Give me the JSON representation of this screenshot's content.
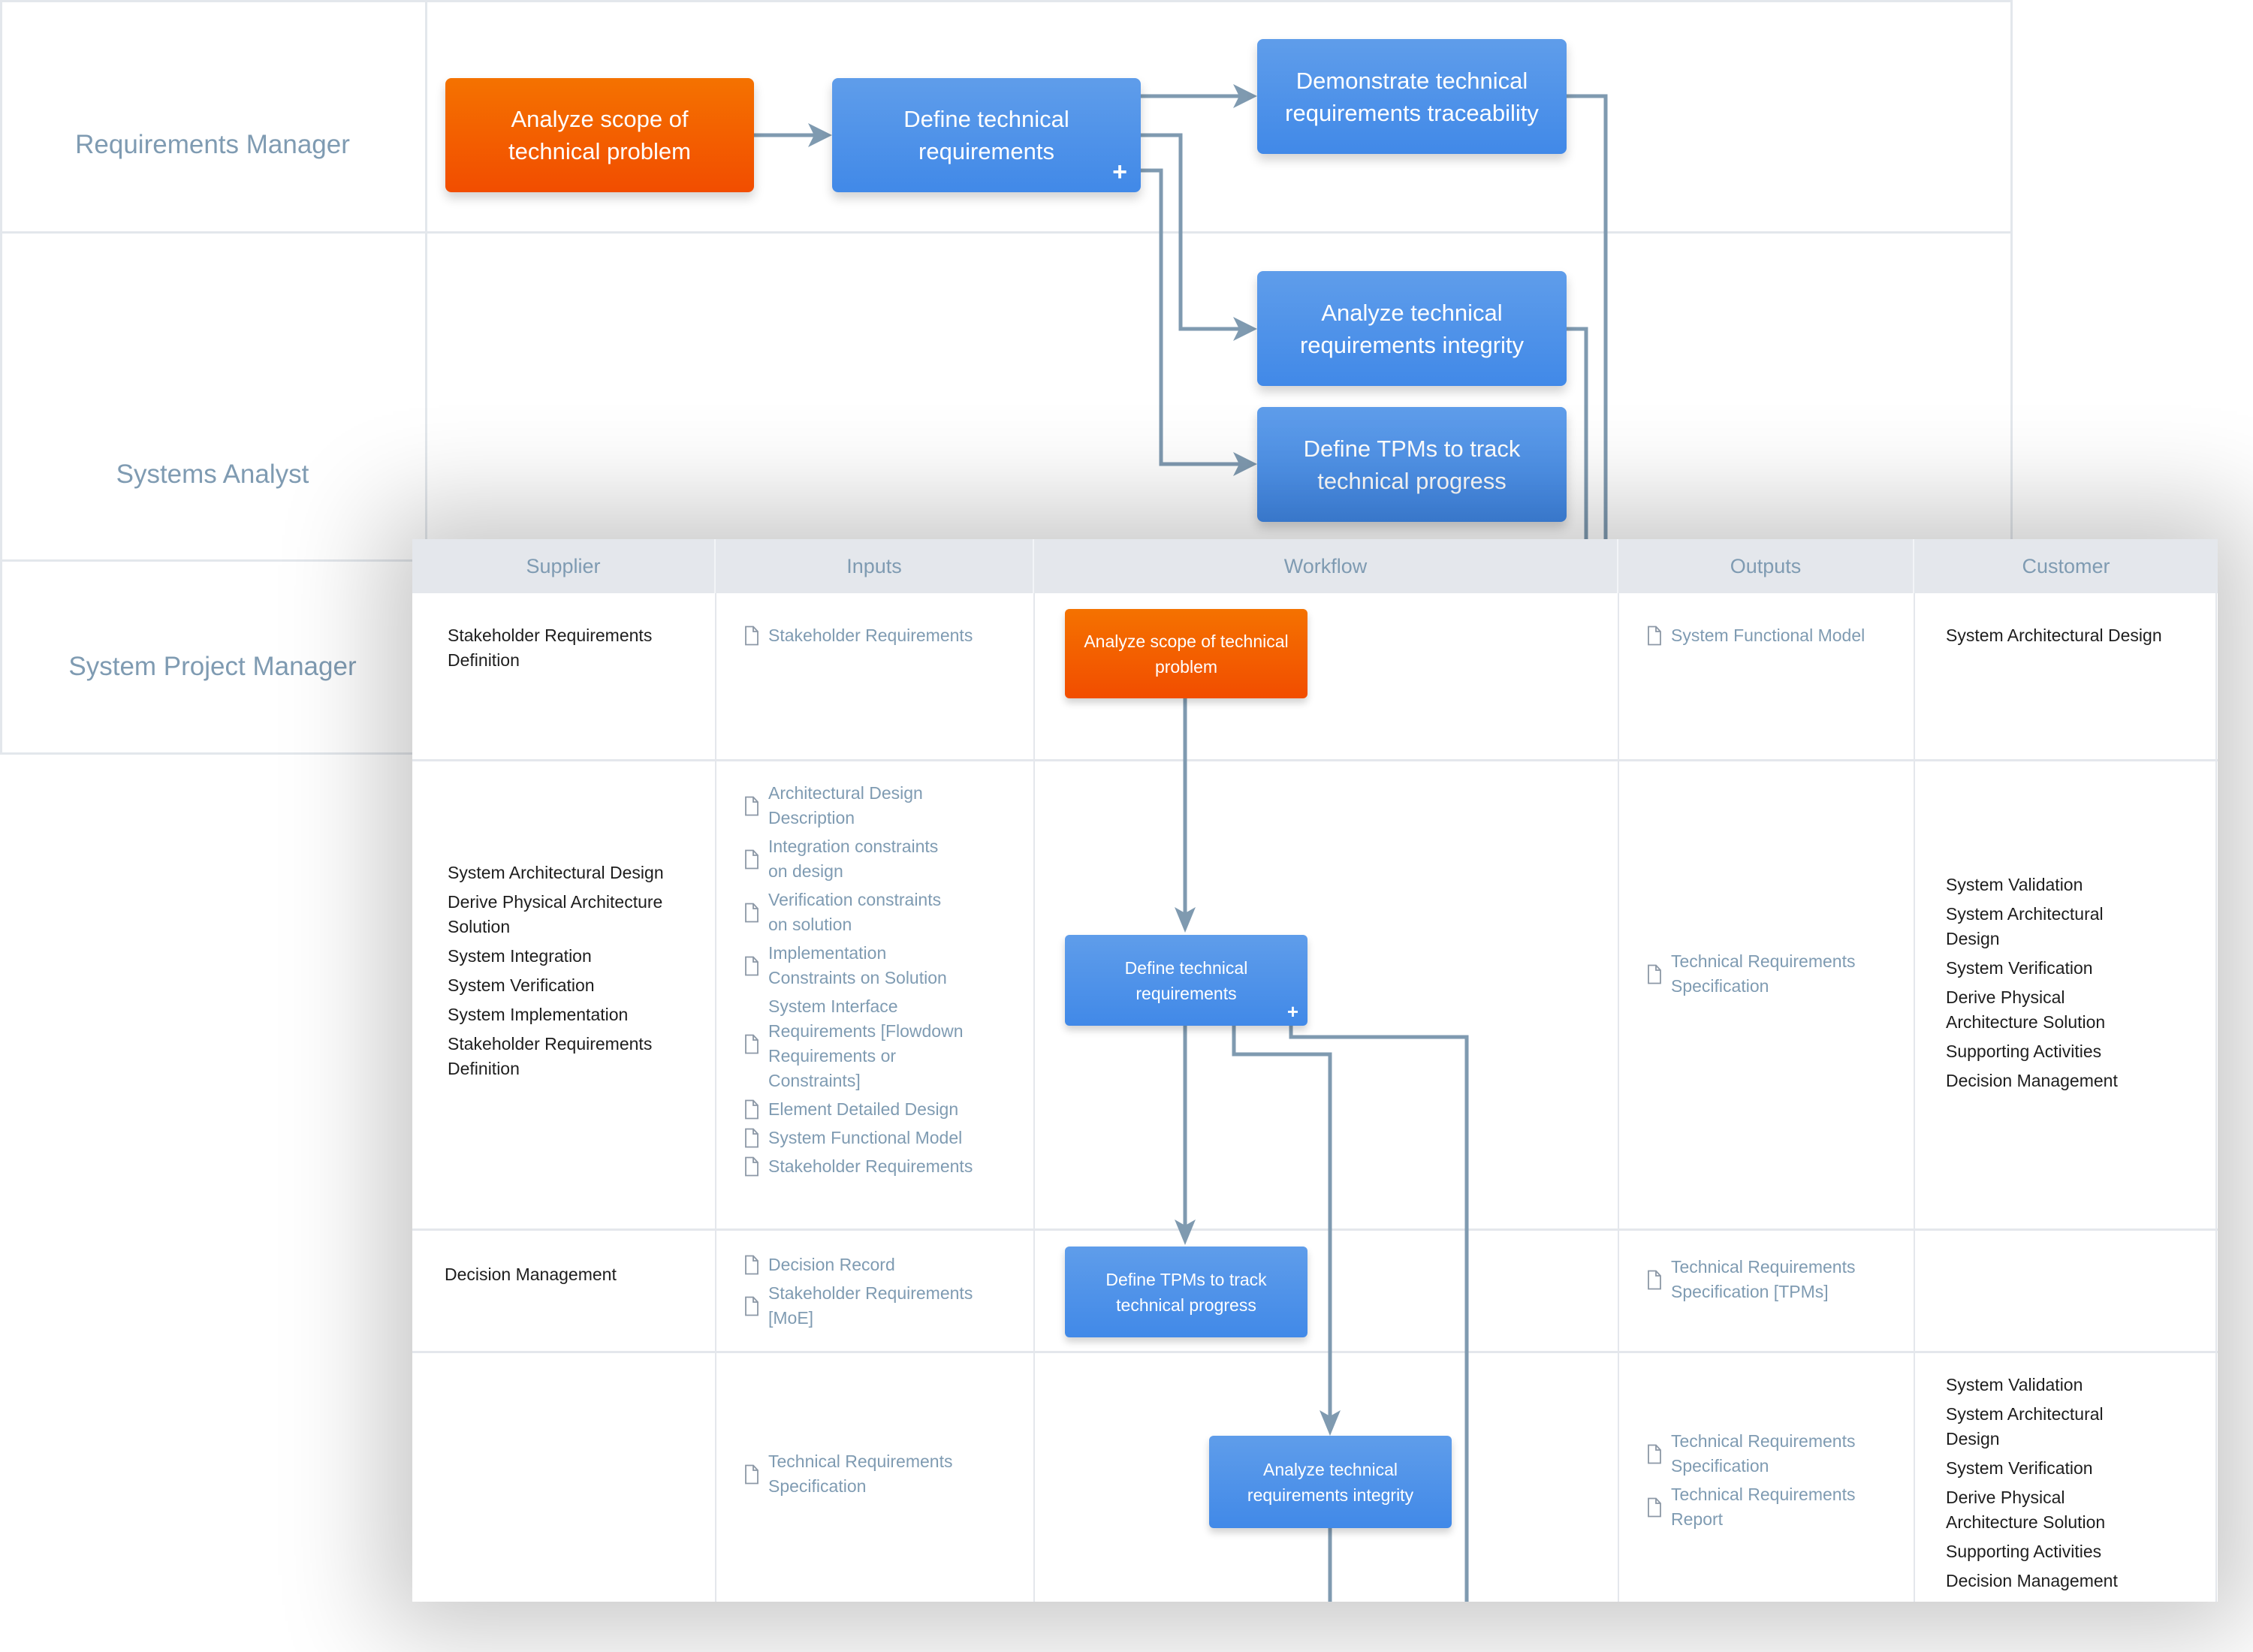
{
  "swimlane": {
    "lanes": [
      {
        "label": "Requirements Manager"
      },
      {
        "label": "Systems Analyst"
      },
      {
        "label": "System Project Manager"
      }
    ],
    "nodes": {
      "analyze_scope": {
        "label": "Analyze scope of technical problem",
        "color": "#f25c00"
      },
      "define_reqs": {
        "label": "Define technical requirements",
        "expandable": true,
        "expand_glyph": "+",
        "color": "#4a8fe8"
      },
      "demonstrate_trace": {
        "label": "Demonstrate technical requirements traceability",
        "color": "#4a8fe8"
      },
      "analyze_integrity": {
        "label": "Analyze technical requirements integrity",
        "color": "#4a8fe8"
      },
      "define_tpms": {
        "label": "Define TPMs to track technical progress",
        "color": "#4a8fe8"
      }
    },
    "connector_color": "#7f9ab0"
  },
  "sipoc": {
    "headers": [
      "Supplier",
      "Inputs",
      "Workflow",
      "Outputs",
      "Customer"
    ],
    "rows": [
      {
        "suppliers": [
          "Stakeholder Requirements Definition"
        ],
        "inputs": [
          "Stakeholder Requirements"
        ],
        "workflow": {
          "label": "Analyze scope of technical problem",
          "kind": "start"
        },
        "outputs": [
          "System Functional Model"
        ],
        "customers": [
          "System Architectural Design"
        ]
      },
      {
        "suppliers": [
          "System Architectural Design",
          "Derive Physical Architecture Solution",
          "System Integration",
          "System Verification",
          "System Implementation",
          "Stakeholder Requirements Definition"
        ],
        "inputs": [
          "Architectural Design Description",
          "Integration constraints on design",
          "Verification constraints on solution",
          "Implementation Constraints on Solution",
          "System Interface Requirements [Flowdown Requirements or  Constraints]",
          "Element Detailed Design",
          "System Functional Model",
          "Stakeholder Requirements"
        ],
        "workflow": {
          "label": "Define technical requirements",
          "kind": "task",
          "expandable": true,
          "expand_glyph": "+"
        },
        "outputs": [
          "Technical Requirements Specification"
        ],
        "customers": [
          "System Validation",
          "System Architectural Design",
          "System Verification",
          "Derive Physical Architecture Solution",
          "Supporting Activities",
          "Decision Management"
        ]
      },
      {
        "suppliers": [
          "Decision Management"
        ],
        "inputs": [
          "Decision Record",
          "Stakeholder Requirements [MoE]"
        ],
        "workflow": {
          "label": "Define TPMs to track technical progress",
          "kind": "task"
        },
        "outputs": [
          "Technical Requirements Specification [TPMs]"
        ],
        "customers": []
      },
      {
        "suppliers": [],
        "inputs": [
          "Technical Requirements Specification"
        ],
        "workflow": {
          "label": "Analyze technical requirements integrity",
          "kind": "task"
        },
        "outputs": [
          "Technical Requirements Specification",
          "Technical Requirements Report"
        ],
        "customers": [
          "System Validation",
          "System Architectural Design",
          "System Verification",
          "Derive Physical Architecture Solution",
          "Supporting Activities",
          "Decision Management"
        ]
      }
    ],
    "icons": {
      "document": "document-icon"
    }
  }
}
